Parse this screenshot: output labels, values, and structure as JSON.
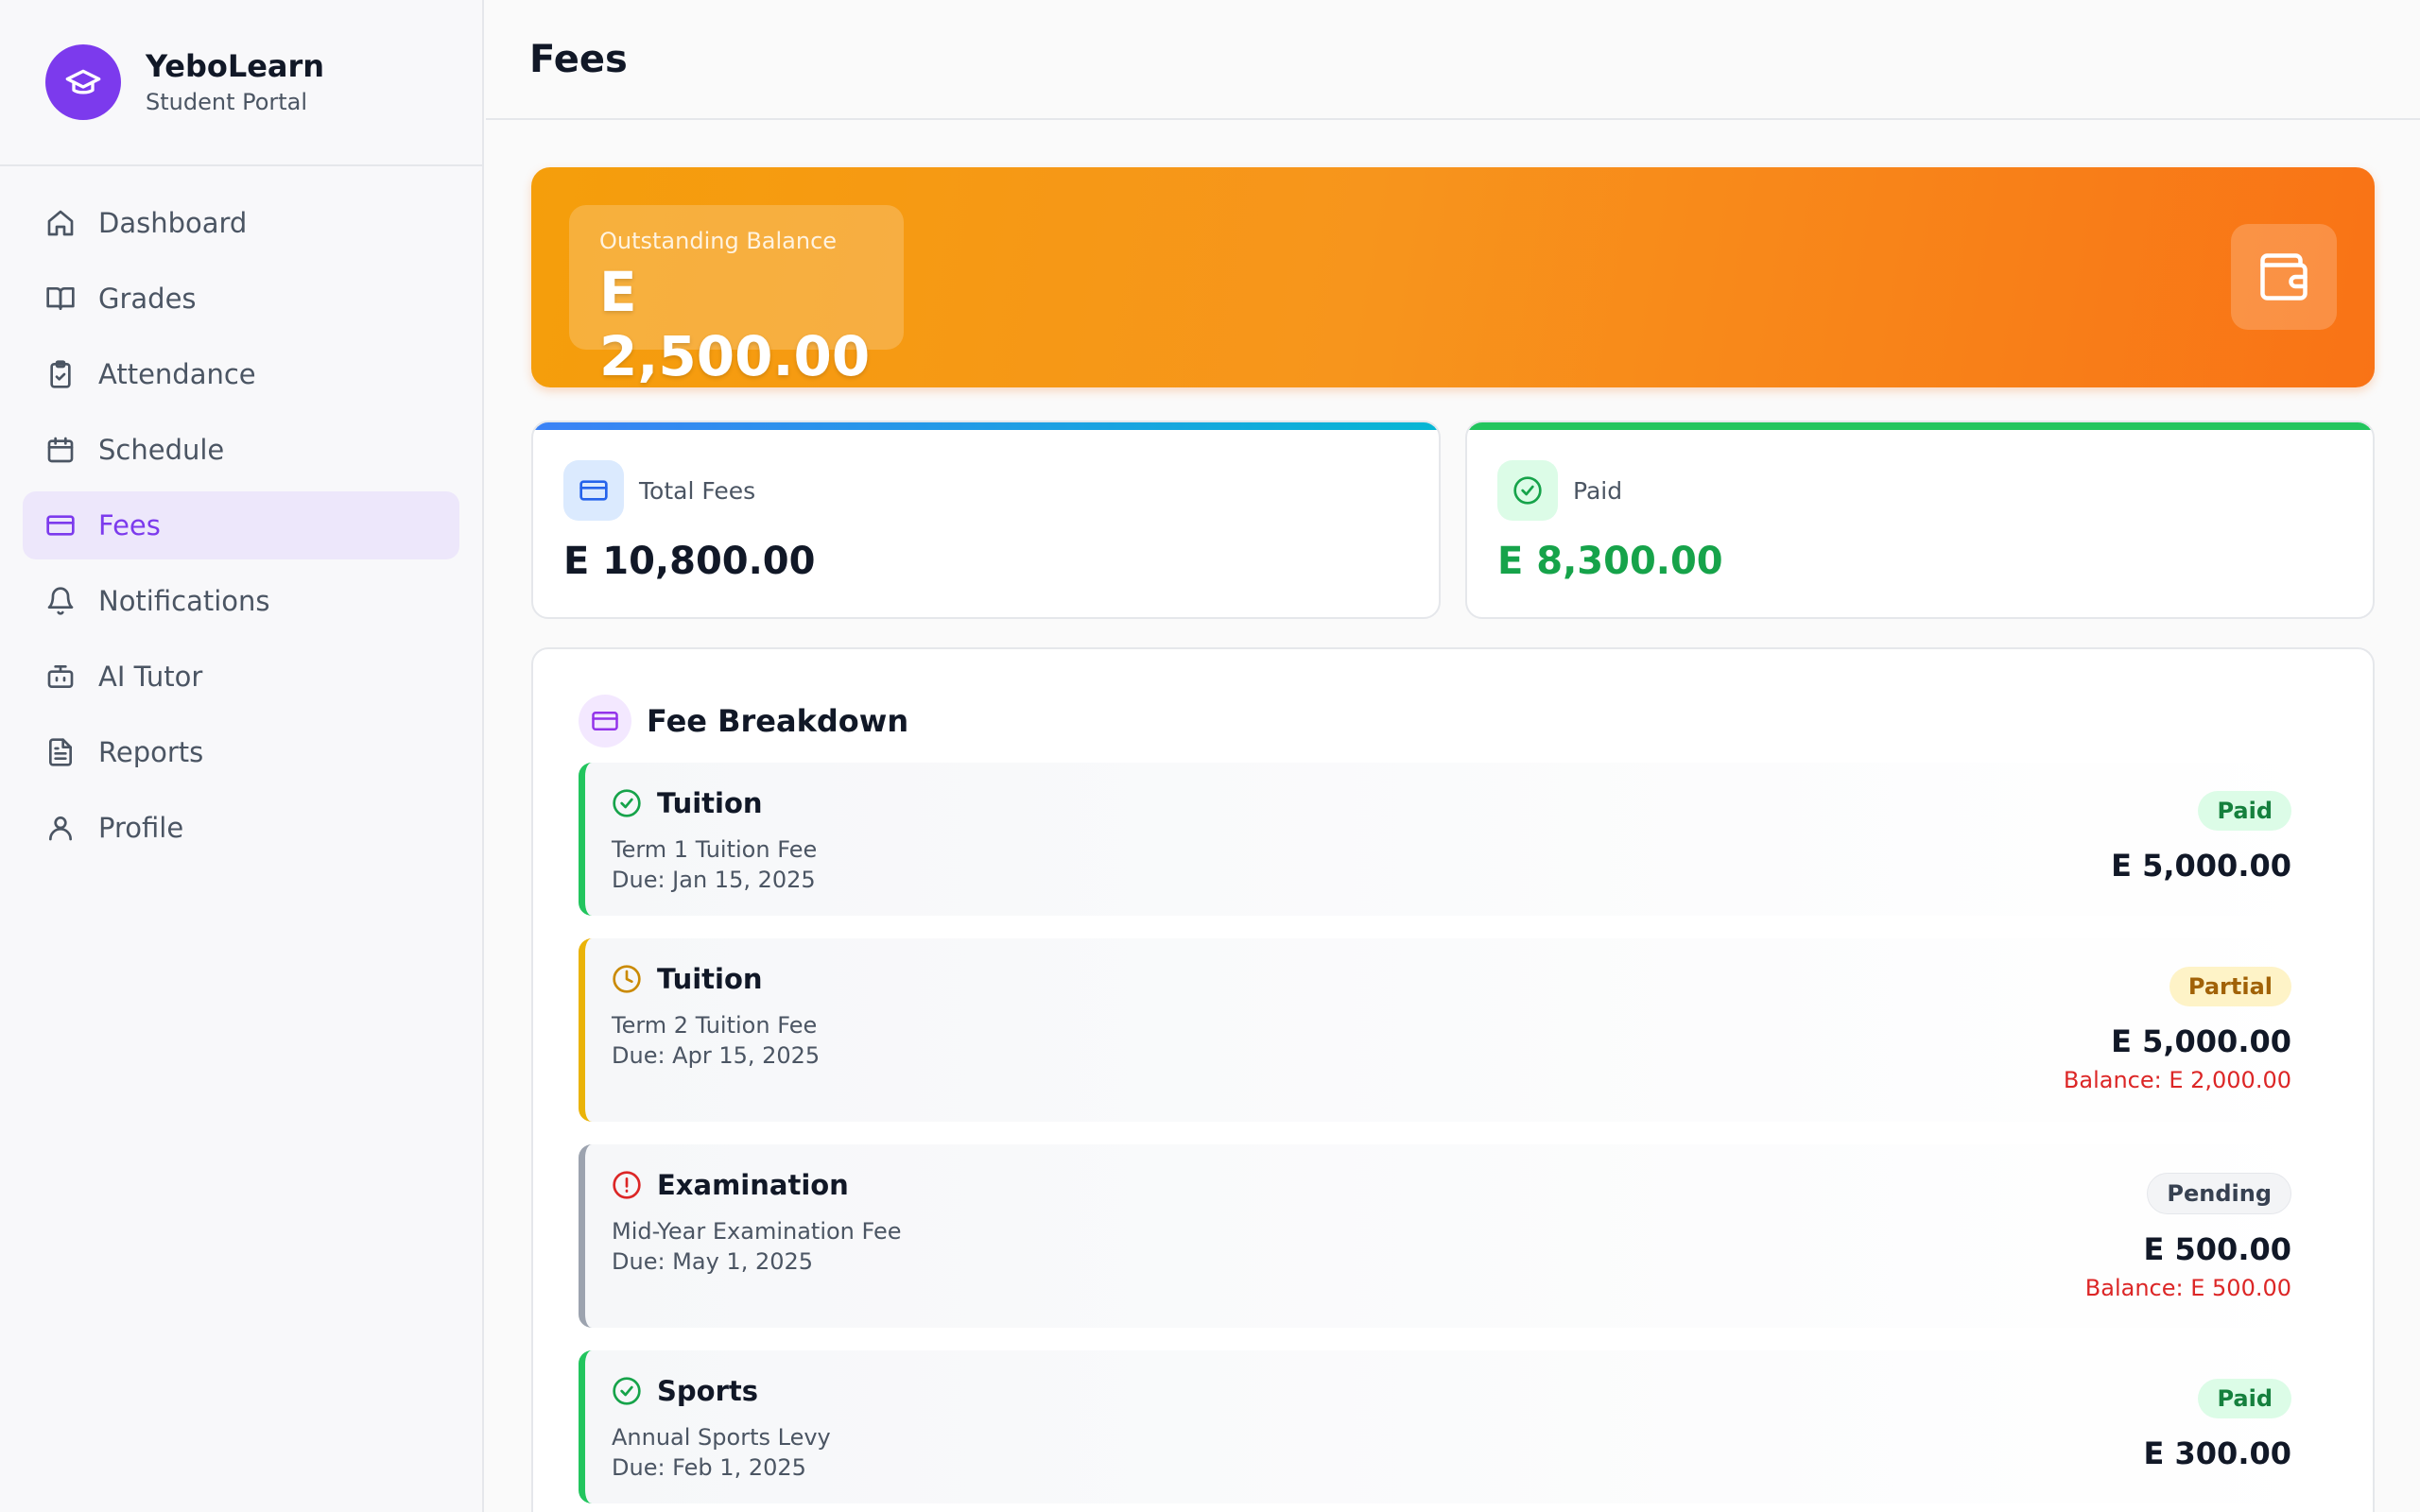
{
  "brand": {
    "title": "YeboLearn",
    "subtitle": "Student Portal"
  },
  "nav": {
    "items": [
      {
        "label": "Dashboard",
        "icon": "home-icon"
      },
      {
        "label": "Grades",
        "icon": "book-icon"
      },
      {
        "label": "Attendance",
        "icon": "clipboard-check-icon"
      },
      {
        "label": "Schedule",
        "icon": "calendar-icon"
      },
      {
        "label": "Fees",
        "icon": "credit-card-icon",
        "active": true
      },
      {
        "label": "Notifications",
        "icon": "bell-icon"
      },
      {
        "label": "AI Tutor",
        "icon": "bot-icon"
      },
      {
        "label": "Reports",
        "icon": "file-text-icon"
      },
      {
        "label": "Profile",
        "icon": "user-icon"
      }
    ]
  },
  "header": {
    "title": "Fees"
  },
  "balance": {
    "label": "Outstanding Balance",
    "value": "E 2,500.00",
    "icon": "wallet-icon"
  },
  "stats": {
    "total": {
      "label": "Total Fees",
      "value": "E 10,800.00",
      "icon": "credit-card-icon",
      "color": "#3b82f6"
    },
    "paid": {
      "label": "Paid",
      "value": "E 8,300.00",
      "icon": "check-circle-icon",
      "color": "#22c55e"
    }
  },
  "breakdown": {
    "title": "Fee Breakdown",
    "items": [
      {
        "category": "Tuition",
        "description": "Term 1 Tuition Fee",
        "due": "Due: Jan 15, 2025",
        "status": "Paid",
        "amount": "E 5,000.00",
        "balance": "",
        "color": "#22c55e"
      },
      {
        "category": "Tuition",
        "description": "Term 2 Tuition Fee",
        "due": "Due: Apr 15, 2025",
        "status": "Partial",
        "amount": "E 5,000.00",
        "balance": "Balance: E 2,000.00",
        "color": "#eab308"
      },
      {
        "category": "Examination",
        "description": "Mid-Year Examination Fee",
        "due": "Due: May 1, 2025",
        "status": "Pending",
        "amount": "E 500.00",
        "balance": "Balance: E 500.00",
        "color": "#9ca3af"
      },
      {
        "category": "Sports",
        "description": "Annual Sports Levy",
        "due": "Due: Feb 1, 2025",
        "status": "Paid",
        "amount": "E 300.00",
        "balance": "",
        "color": "#22c55e"
      }
    ]
  }
}
